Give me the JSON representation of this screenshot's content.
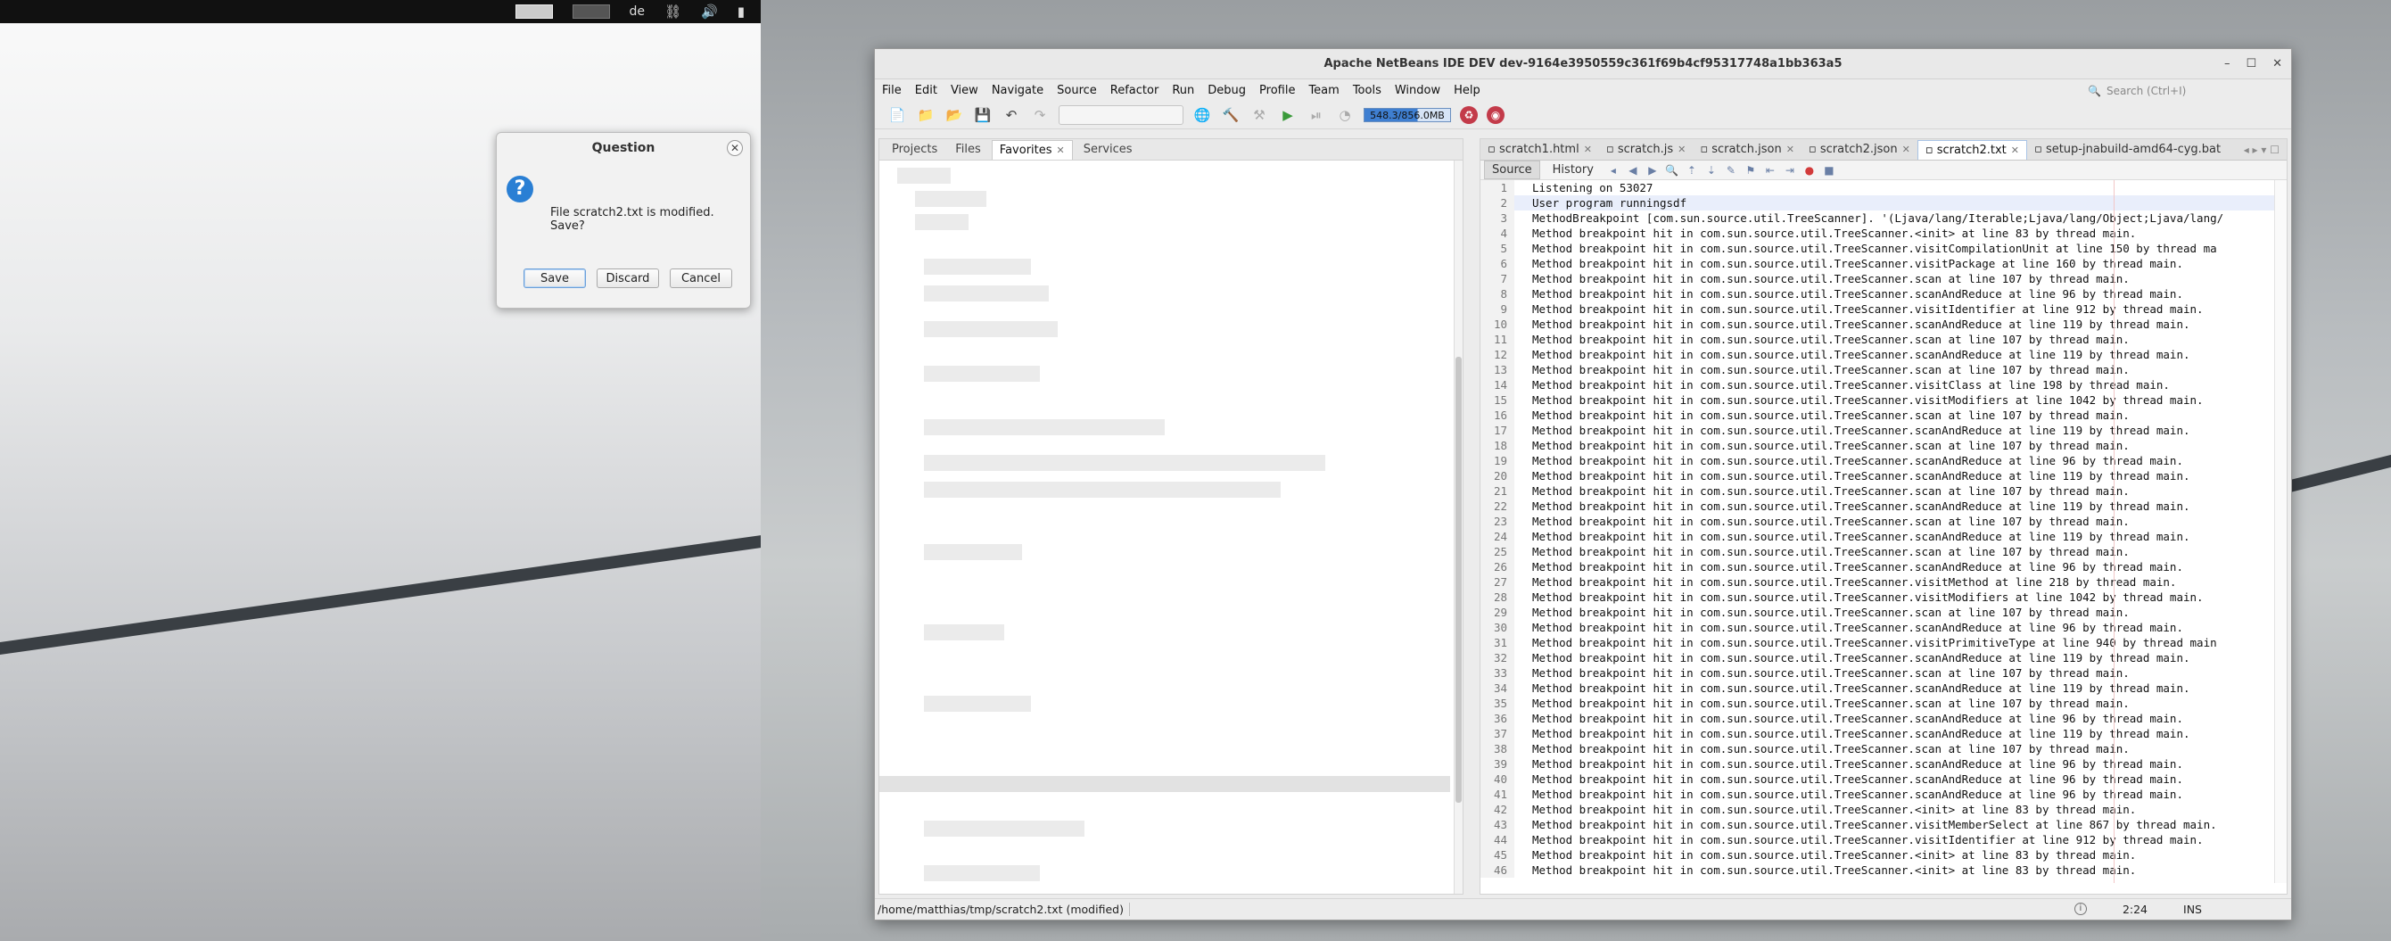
{
  "topbar": {
    "workspaces": [
      "ws1",
      "ws2"
    ],
    "label": "de",
    "icons": [
      "network-icon",
      "volume-icon",
      "battery-icon"
    ]
  },
  "dialog": {
    "title": "Question",
    "message": "File scratch2.txt is modified. Save?",
    "buttons": {
      "save": "Save",
      "discard": "Discard",
      "cancel": "Cancel"
    }
  },
  "ide": {
    "title": "Apache NetBeans IDE DEV dev-9164e3950559c361f69b4cf95317748a1bb363a5",
    "menu": [
      "File",
      "Edit",
      "View",
      "Navigate",
      "Source",
      "Refactor",
      "Run",
      "Debug",
      "Profile",
      "Team",
      "Tools",
      "Window",
      "Help"
    ],
    "search_placeholder": "Search (Ctrl+I)",
    "memory": "548.3/856.0MB",
    "panel_tabs": [
      "Projects",
      "Files",
      "Favorites",
      "Services"
    ],
    "active_panel_tab": "Favorites",
    "file_tabs": [
      "scratch1.html",
      "scratch.js",
      "scratch.json",
      "scratch2.json",
      "scratch2.txt",
      "setup-jnabuild-amd64-cyg.bat"
    ],
    "active_file_tab": "scratch2.txt",
    "editor_subtabs": [
      "Source",
      "History"
    ],
    "code_lines": [
      "Listening on 53027",
      "User program runningsdf",
      "MethodBreakpoint [com.sun.source.util.TreeScanner]. '(Ljava/lang/Iterable;Ljava/lang/Object;Ljava/lang/",
      "Method breakpoint hit in com.sun.source.util.TreeScanner.<init> at line 83 by thread main.",
      "Method breakpoint hit in com.sun.source.util.TreeScanner.visitCompilationUnit at line 150 by thread ma",
      "Method breakpoint hit in com.sun.source.util.TreeScanner.visitPackage at line 160 by thread main.",
      "Method breakpoint hit in com.sun.source.util.TreeScanner.scan at line 107 by thread main.",
      "Method breakpoint hit in com.sun.source.util.TreeScanner.scanAndReduce at line 96 by thread main.",
      "Method breakpoint hit in com.sun.source.util.TreeScanner.visitIdentifier at line 912 by thread main.",
      "Method breakpoint hit in com.sun.source.util.TreeScanner.scanAndReduce at line 119 by thread main.",
      "Method breakpoint hit in com.sun.source.util.TreeScanner.scan at line 107 by thread main.",
      "Method breakpoint hit in com.sun.source.util.TreeScanner.scanAndReduce at line 119 by thread main.",
      "Method breakpoint hit in com.sun.source.util.TreeScanner.scan at line 107 by thread main.",
      "Method breakpoint hit in com.sun.source.util.TreeScanner.visitClass at line 198 by thread main.",
      "Method breakpoint hit in com.sun.source.util.TreeScanner.visitModifiers at line 1042 by thread main.",
      "Method breakpoint hit in com.sun.source.util.TreeScanner.scan at line 107 by thread main.",
      "Method breakpoint hit in com.sun.source.util.TreeScanner.scanAndReduce at line 119 by thread main.",
      "Method breakpoint hit in com.sun.source.util.TreeScanner.scan at line 107 by thread main.",
      "Method breakpoint hit in com.sun.source.util.TreeScanner.scanAndReduce at line 96 by thread main.",
      "Method breakpoint hit in com.sun.source.util.TreeScanner.scanAndReduce at line 119 by thread main.",
      "Method breakpoint hit in com.sun.source.util.TreeScanner.scan at line 107 by thread main.",
      "Method breakpoint hit in com.sun.source.util.TreeScanner.scanAndReduce at line 119 by thread main.",
      "Method breakpoint hit in com.sun.source.util.TreeScanner.scan at line 107 by thread main.",
      "Method breakpoint hit in com.sun.source.util.TreeScanner.scanAndReduce at line 119 by thread main.",
      "Method breakpoint hit in com.sun.source.util.TreeScanner.scan at line 107 by thread main.",
      "Method breakpoint hit in com.sun.source.util.TreeScanner.scanAndReduce at line 96 by thread main.",
      "Method breakpoint hit in com.sun.source.util.TreeScanner.visitMethod at line 218 by thread main.",
      "Method breakpoint hit in com.sun.source.util.TreeScanner.visitModifiers at line 1042 by thread main.",
      "Method breakpoint hit in com.sun.source.util.TreeScanner.scan at line 107 by thread main.",
      "Method breakpoint hit in com.sun.source.util.TreeScanner.scanAndReduce at line 96 by thread main.",
      "Method breakpoint hit in com.sun.source.util.TreeScanner.visitPrimitiveType at line 940 by thread main",
      "Method breakpoint hit in com.sun.source.util.TreeScanner.scanAndReduce at line 119 by thread main.",
      "Method breakpoint hit in com.sun.source.util.TreeScanner.scan at line 107 by thread main.",
      "Method breakpoint hit in com.sun.source.util.TreeScanner.scanAndReduce at line 119 by thread main.",
      "Method breakpoint hit in com.sun.source.util.TreeScanner.scan at line 107 by thread main.",
      "Method breakpoint hit in com.sun.source.util.TreeScanner.scanAndReduce at line 96 by thread main.",
      "Method breakpoint hit in com.sun.source.util.TreeScanner.scanAndReduce at line 119 by thread main.",
      "Method breakpoint hit in com.sun.source.util.TreeScanner.scan at line 107 by thread main.",
      "Method breakpoint hit in com.sun.source.util.TreeScanner.scanAndReduce at line 96 by thread main.",
      "Method breakpoint hit in com.sun.source.util.TreeScanner.scanAndReduce at line 96 by thread main.",
      "Method breakpoint hit in com.sun.source.util.TreeScanner.scanAndReduce at line 96 by thread main.",
      "Method breakpoint hit in com.sun.source.util.TreeScanner.<init> at line 83 by thread main.",
      "Method breakpoint hit in com.sun.source.util.TreeScanner.visitMemberSelect at line 867 by thread main.",
      "Method breakpoint hit in com.sun.source.util.TreeScanner.visitIdentifier at line 912 by thread main.",
      "Method breakpoint hit in com.sun.source.util.TreeScanner.<init> at line 83 by thread main.",
      "Method breakpoint hit in com.sun.source.util.TreeScanner.<init> at line 83 by thread main."
    ],
    "status": {
      "path": "/home/matthias/tmp/scratch2.txt (modified)",
      "position": "2:24",
      "mode": "INS"
    }
  }
}
